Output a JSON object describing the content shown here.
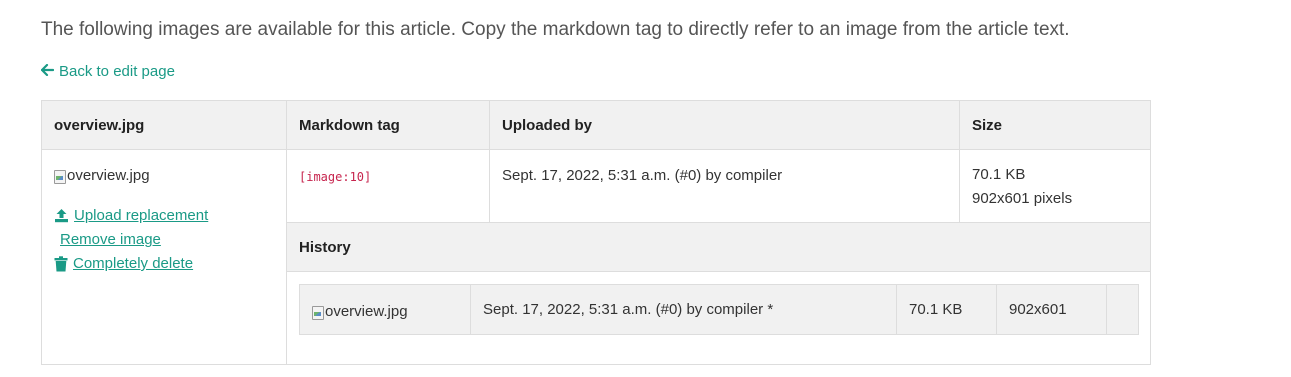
{
  "intro": "The following images are available for this article. Copy the markdown tag to directly refer to an image from the article text.",
  "back_link": {
    "icon": "arrow-left-icon",
    "label": "Back to edit page"
  },
  "colors": {
    "link": "#1a9a86",
    "code": "#c7254e",
    "header_bg": "#f1f1f1",
    "border": "#dddddd"
  },
  "table": {
    "headers": {
      "image": "overview.jpg",
      "markdown": "Markdown tag",
      "uploaded_by": "Uploaded by",
      "size": "Size"
    },
    "image": {
      "alt": "overview.jpg",
      "markdown_tag": "[image:10]",
      "uploaded": "Sept. 17, 2022, 5:31 a.m. (#0) by compiler",
      "size": "70.1 KB",
      "dimensions": "902x601 pixels"
    },
    "actions": {
      "upload": {
        "icon": "upload-icon",
        "label": "Upload replacement"
      },
      "remove": {
        "label": "Remove image"
      },
      "delete": {
        "icon": "trash-icon",
        "label": "Completely delete"
      }
    },
    "history": {
      "title": "History",
      "rows": [
        {
          "alt": "overview.jpg",
          "uploaded": "Sept. 17, 2022, 5:31 a.m. (#0) by compiler *",
          "size": "70.1 KB",
          "dimensions": "902x601"
        }
      ]
    }
  }
}
